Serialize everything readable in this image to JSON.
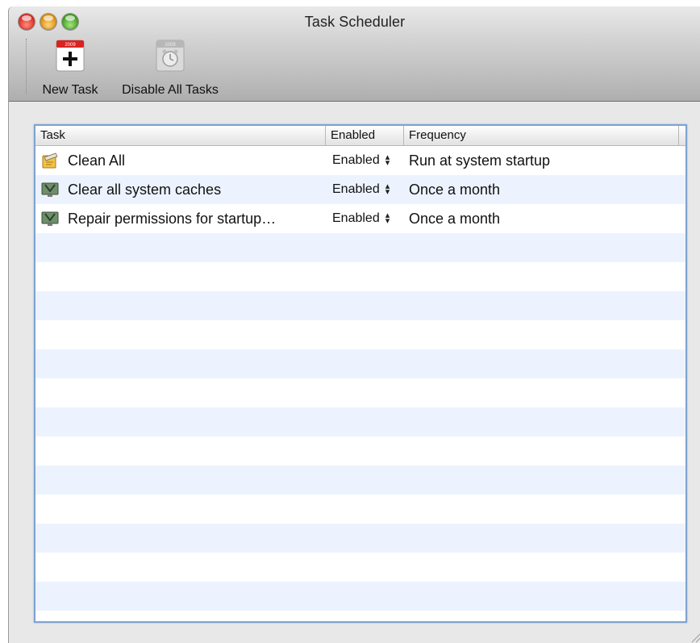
{
  "window": {
    "title": "Task Scheduler"
  },
  "toolbar": {
    "new_task_label": "New Task",
    "disable_all_label": "Disable All Tasks",
    "new_task_icon": "calendar-add-icon",
    "disable_all_icon": "calendar-clock-disabled-icon",
    "calendar_year": "2009"
  },
  "table": {
    "columns": [
      "Task",
      "Enabled",
      "Frequency"
    ],
    "rows": [
      {
        "icon": "broom-clean-icon",
        "task": "Clean All",
        "enabled": "Enabled",
        "frequency": "Run at system startup"
      },
      {
        "icon": "system-cleanup-icon",
        "task": "Clear all system caches",
        "enabled": "Enabled",
        "frequency": "Once a month"
      },
      {
        "icon": "system-cleanup-icon",
        "task": "Repair permissions for startup…",
        "enabled": "Enabled",
        "frequency": "Once a month"
      }
    ],
    "empty_rows": 13
  },
  "colors": {
    "row_alt": "#edf3fe",
    "focus_ring": "#7fa3cf"
  }
}
